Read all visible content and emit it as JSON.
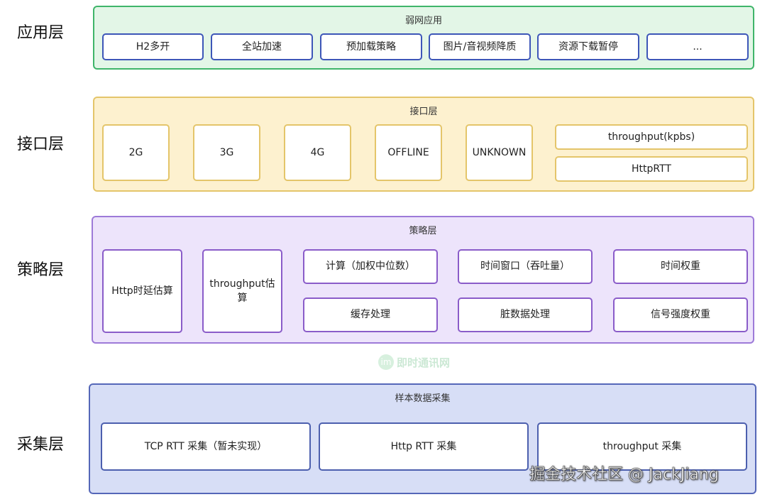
{
  "layers": {
    "app": {
      "label": "应用层",
      "title": "弱网应用",
      "items": [
        "H2多开",
        "全站加速",
        "预加载策略",
        "图片/音视频降质",
        "资源下载暂停",
        "..."
      ]
    },
    "api": {
      "label": "接口层",
      "title": "接口层",
      "items": [
        "2G",
        "3G",
        "4G",
        "OFFLINE",
        "UNKNOWN"
      ],
      "metrics": [
        "throughput(kpbs)",
        "HttpRTT"
      ]
    },
    "strategy": {
      "label": "策略层",
      "title": "策略层",
      "estimators": [
        "Http时延估算",
        "throughput估算"
      ],
      "grid": [
        "计算（加权中位数）",
        "时间窗口（吞吐量）",
        "时间权重",
        "缓存处理",
        "脏数据处理",
        "信号强度权重"
      ]
    },
    "collect": {
      "label": "采集层",
      "title": "样本数据采集",
      "items": [
        "TCP RTT 采集（暂未实现）",
        "Http RTT 采集",
        "throughput 采集"
      ]
    }
  },
  "watermarks": {
    "center_logo": "im",
    "center": "即时通讯网",
    "bottom_right": "掘金技术社区 @ JackJiang"
  },
  "colors": {
    "app_bg": "#e3f6e7",
    "app_border": "#3fb56a",
    "app_box_border": "#3d56b8",
    "api_bg": "#fdf1cf",
    "api_border": "#e4c56a",
    "strategy_bg": "#ede4fb",
    "strategy_border": "#9d7ad8",
    "collect_bg": "#d7def6",
    "collect_border": "#5567b8"
  }
}
